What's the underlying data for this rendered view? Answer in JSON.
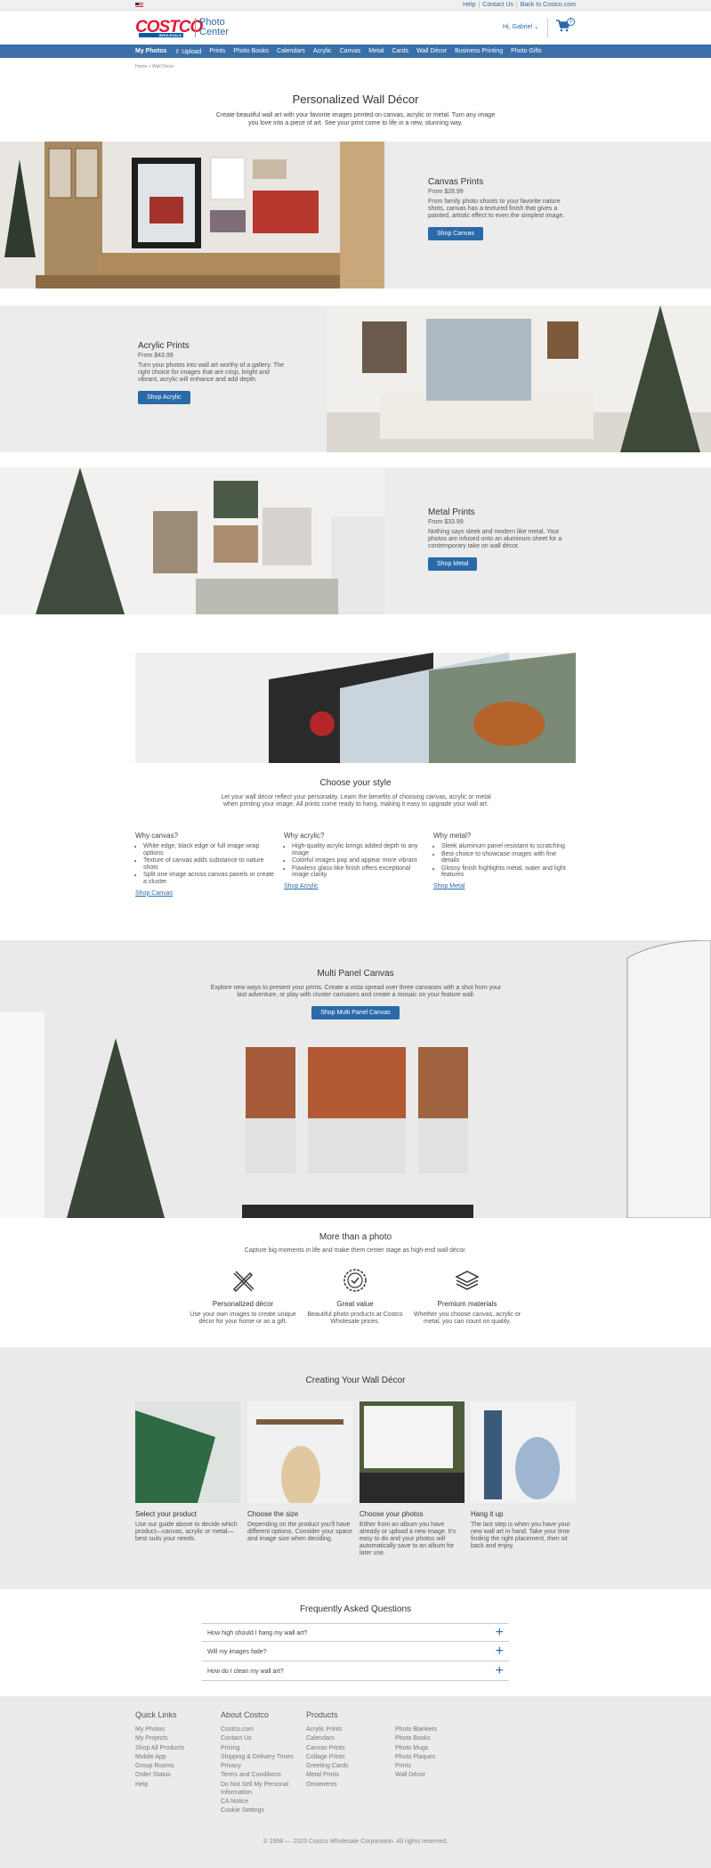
{
  "topbar": {
    "links": [
      "Help",
      "Contact Us",
      "Back to Costco.com"
    ]
  },
  "header": {
    "logo_main": "COSTCO",
    "logo_sub": "WHOLESALE",
    "logo_photo": "Photo",
    "logo_center": "Center",
    "account": "Hi, Gabriel",
    "cart_count": "1"
  },
  "nav": {
    "items": [
      "My Photos",
      "Upload",
      "Prints",
      "Photo Books",
      "Calendars",
      "Acrylic",
      "Canvas",
      "Metal",
      "Cards",
      "Wall Décor",
      "Business Printing",
      "Photo Gifts"
    ]
  },
  "breadcrumb": "Home > Wall Décor",
  "hero": {
    "title": "Personalized Wall Décor",
    "text": "Create beautiful wall art with your favorite images printed on canvas, acrylic or metal. Turn any image you love into a piece of art. See your print come to life in a new, stunning way."
  },
  "canvas": {
    "title": "Canvas Prints",
    "price": "From $28.99",
    "text": "From family photo shoots to your favorite nature shots, canvas has a textured finish that gives a painted, artistic effect to even the simplest image.",
    "button": "Shop Canvas"
  },
  "acrylic": {
    "title": "Acrylic Prints",
    "price": "From $43.99",
    "text": "Turn your photos into wall art worthy of a gallery. The right choice for images that are crisp, bright and vibrant, acrylic will enhance and add depth.",
    "button": "Shop Acrylic"
  },
  "metal": {
    "title": "Metal Prints",
    "price": "From $33.99",
    "text": "Nothing says sleek and modern like metal. Your photos are infused onto an aluminum sheet for a contemporary take on wall décor.",
    "button": "Shop Metal"
  },
  "style": {
    "title": "Choose your style",
    "text": "Let your wall décor reflect your personality. Learn the benefits of choosing canvas, acrylic or metal when printing your image. All prints come ready to hang, making it easy to upgrade your wall art.",
    "columns": [
      {
        "title": "Why canvas?",
        "items": [
          "White edge, black edge or full image wrap options",
          "Texture of canvas adds substance to nature shots",
          "Split one image across canvas panels or create a cluster"
        ],
        "link": "Shop Canvas"
      },
      {
        "title": "Why acrylic?",
        "items": [
          "High-quality acrylic brings added depth to any image",
          "Colorful images pop and appear more vibrant",
          "Flawless glass-like finish offers exceptional image clarity"
        ],
        "link": "Shop Acrylic"
      },
      {
        "title": "Why metal?",
        "items": [
          "Sleek aluminum panel resistant to scratching",
          "Best choice to showcase images with fine details",
          "Glossy finish highlights metal, water and light features"
        ],
        "link": "Shop Metal"
      }
    ]
  },
  "multi": {
    "title": "Multi Panel Canvas",
    "text": "Explore new ways to present your prints. Create a vista spread over three canvases with a shot from your last adventure, or play with cluster canvases and create a mosaic on your feature wall.",
    "button": "Shop Multi Panel Canvas"
  },
  "more": {
    "title": "More than a photo",
    "text": "Capture big moments in life and make them center stage as high-end wall décor.",
    "features": [
      {
        "icon": "pencil-ruler-icon",
        "title": "Personalized décor",
        "text": "Use your own images to create unique décor for your home or as a gift."
      },
      {
        "icon": "badge-check-icon",
        "title": "Great value",
        "text": "Beautiful photo products at Costco Wholesale prices."
      },
      {
        "icon": "layers-icon",
        "title": "Premium materials",
        "text": "Whether you choose canvas, acrylic or metal, you can count on quality."
      }
    ]
  },
  "creating": {
    "title": "Creating Your Wall Décor",
    "steps": [
      {
        "title": "Select your product",
        "text": "Use our guide above to decide which product—canvas, acrylic or metal—best suits your needs."
      },
      {
        "title": "Choose the size",
        "text": "Depending on the product you'll have different options. Consider your space and image size when deciding."
      },
      {
        "title": "Choose your photos",
        "text": "Either from an album you have already or upload a new image. It's easy to do and your photos will automatically save to an album for later use."
      },
      {
        "title": "Hang it up",
        "text": "The last step is when you have your new wall art in hand. Take your time finding the right placement, then sit back and enjoy."
      }
    ]
  },
  "faq": {
    "title": "Frequently Asked Questions",
    "items": [
      "How high should I hang my wall art?",
      "Will my images fade?",
      "How do I clean my wall art?"
    ]
  },
  "footer": {
    "quick": {
      "title": "Quick Links",
      "items": [
        "My Photos",
        "My Projects",
        "Shop All Products",
        "Mobile App",
        "Group Rooms",
        "Order Status",
        "Help"
      ]
    },
    "about": {
      "title": "About Costco",
      "items": [
        "Costco.com",
        "Contact Us",
        "Pricing",
        "Shipping & Delivery Times",
        "Privacy",
        "Terms and Conditions",
        "Do Not Sell My Personal Information",
        "CA Notice",
        "Cookie Settings"
      ]
    },
    "products": {
      "title": "Products",
      "items": [
        "Acrylic Prints",
        "Calendars",
        "Canvas Prints",
        "Collage Prints",
        "Greeting Cards",
        "Metal Prints",
        "Ornaments"
      ]
    },
    "products2": {
      "items": [
        "Photo Blankets",
        "Photo Books",
        "Photo Mugs",
        "Photo Plaques",
        "Prints",
        "Wall Décor"
      ]
    },
    "copyright": "© 1998 — 2023 Costco Wholesale Corporation. All rights reserved."
  },
  "colors": {
    "brand_red": "#e31837",
    "brand_blue": "#005daa",
    "nav_blue": "#3a6fa8",
    "button_blue": "#2a6aa8"
  }
}
